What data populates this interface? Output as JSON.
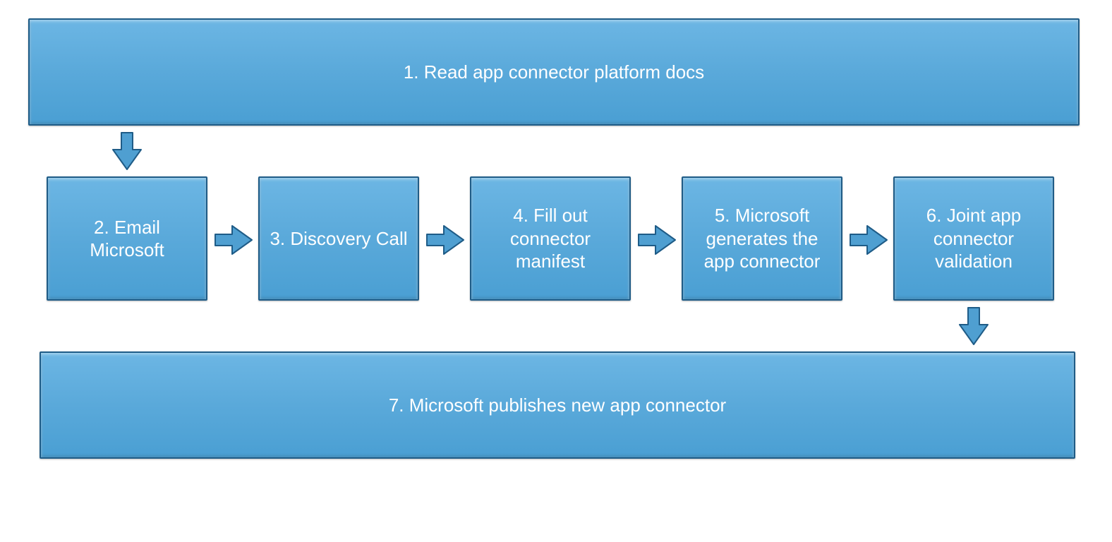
{
  "boxes": {
    "step1": "1. Read app connector platform docs",
    "step2": "2. Email Microsoft",
    "step3": "3. Discovery Call",
    "step4": "4. Fill out connector manifest",
    "step5": "5. Microsoft generates the app connector",
    "step6": "6. Joint app connector validation",
    "step7": "7. Microsoft publishes new app connector"
  },
  "colors": {
    "box_fill": "#5aa9da",
    "box_border": "#1f5c87",
    "arrow_fill": "#4f9fd1"
  }
}
